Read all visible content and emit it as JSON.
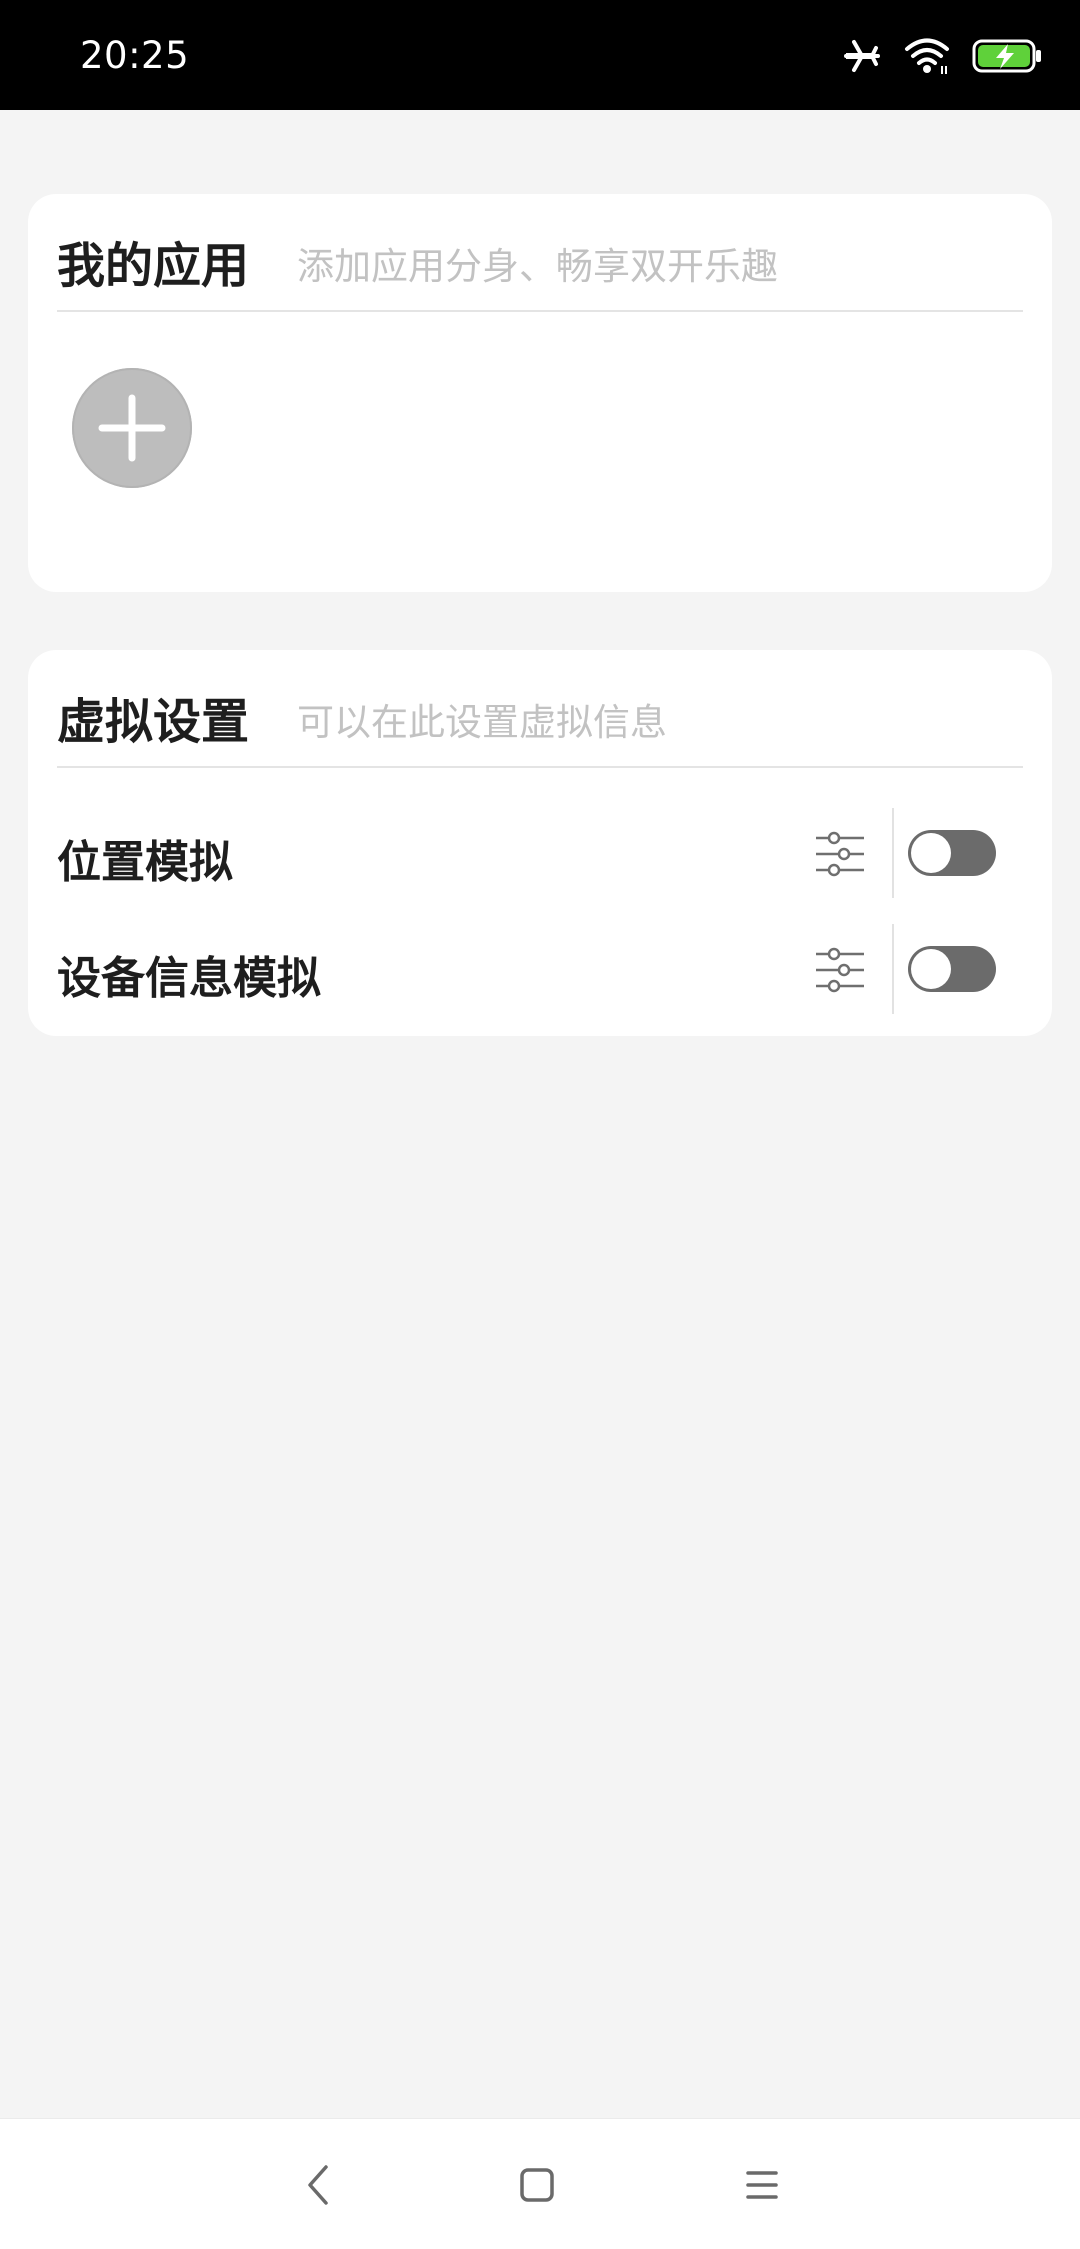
{
  "status_bar": {
    "time": "20:25",
    "icons": [
      "airplane-mode-icon",
      "wifi-icon",
      "battery-charging-icon"
    ],
    "battery_color": "#5fd13a"
  },
  "my_apps": {
    "title": "我的应用",
    "subtitle": "添加应用分身、畅享双开乐趣",
    "add_icon": "plus-icon"
  },
  "virtual_settings": {
    "title": "虚拟设置",
    "subtitle": "可以在此设置虚拟信息",
    "items": [
      {
        "label": "位置模拟",
        "enabled": false,
        "settings_icon": "tune-icon"
      },
      {
        "label": "设备信息模拟",
        "enabled": false,
        "settings_icon": "tune-icon"
      }
    ]
  },
  "nav_bar": {
    "icons": [
      "back-icon",
      "home-icon",
      "menu-icon"
    ]
  },
  "colors": {
    "background": "#f4f4f4",
    "card": "#ffffff",
    "title": "#1e1e1e",
    "subtitle": "#c2c2c2",
    "toggle_off": "#6b6b6b",
    "add_button": "#bdbdbd"
  }
}
